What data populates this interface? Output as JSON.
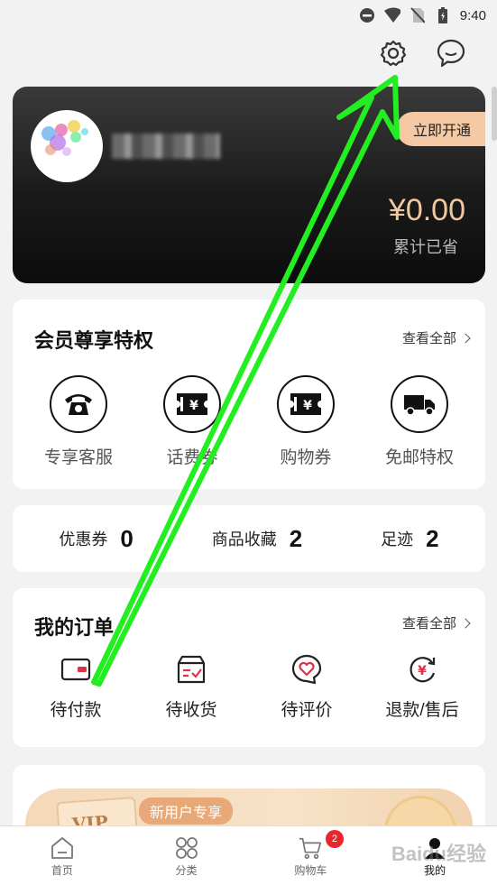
{
  "status_bar": {
    "time": "9:40"
  },
  "top_icons": {
    "settings": "gear-icon",
    "messages": "chat-bubble-icon"
  },
  "vip_card": {
    "open_button": "立即开通",
    "saved_amount": "¥0.00",
    "saved_label": "累计已省"
  },
  "perks": {
    "title": "会员尊享特权",
    "see_all": "查看全部",
    "items": [
      {
        "label": "专享客服",
        "icon": "phone-icon"
      },
      {
        "label": "话费券",
        "icon": "ticket-icon"
      },
      {
        "label": "购物券",
        "icon": "ticket-icon"
      },
      {
        "label": "免邮特权",
        "icon": "truck-icon"
      }
    ]
  },
  "stats": [
    {
      "label": "优惠券",
      "value": "0"
    },
    {
      "label": "商品收藏",
      "value": "2"
    },
    {
      "label": "足迹",
      "value": "2"
    }
  ],
  "orders": {
    "title": "我的订单",
    "see_all": "查看全部",
    "items": [
      {
        "label": "待付款",
        "icon": "wallet-icon"
      },
      {
        "label": "待收货",
        "icon": "package-icon"
      },
      {
        "label": "待评价",
        "icon": "heart-comment-icon"
      },
      {
        "label": "退款/售后",
        "icon": "refund-icon"
      }
    ]
  },
  "promo": {
    "vip_text": "VIP",
    "badge": "新用户专享"
  },
  "tabbar": {
    "items": [
      {
        "label": "首页",
        "icon": "home-icon"
      },
      {
        "label": "分类",
        "icon": "category-icon"
      },
      {
        "label": "购物车",
        "icon": "cart-icon",
        "badge": "2"
      },
      {
        "label": "我的",
        "icon": "user-icon"
      }
    ]
  },
  "watermark": "Baidu经验",
  "colors": {
    "accent": "#f5c9a4",
    "arrow": "#22ee22",
    "badge": "#e8262c"
  }
}
